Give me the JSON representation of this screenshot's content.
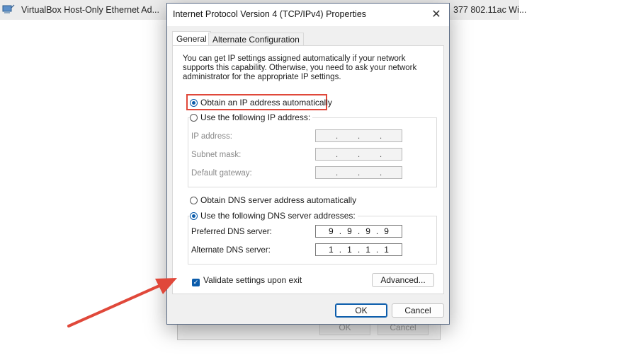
{
  "background": {
    "adapter_left": "VirtualBox Host-Only Ethernet Ad...",
    "adapter_right": "377 802.11ac Wi...",
    "ok_label": "OK",
    "cancel_label": "Cancel"
  },
  "dialog": {
    "title": "Internet Protocol Version 4 (TCP/IPv4) Properties",
    "close_glyph": "✕",
    "tabs": [
      {
        "label": "General",
        "selected": true
      },
      {
        "label": "Alternate Configuration",
        "selected": false
      }
    ],
    "description": "You can get IP settings assigned automatically if your network supports this capability. Otherwise, you need to ask your network administrator for the appropriate IP settings.",
    "ip_options": {
      "auto_label": "Obtain an IP address automatically",
      "manual_label": "Use the following IP address:",
      "selected": "auto"
    },
    "ip_fields": [
      {
        "label": "IP address:",
        "value": ". . ."
      },
      {
        "label": "Subnet mask:",
        "value": ". . ."
      },
      {
        "label": "Default gateway:",
        "value": ". . ."
      }
    ],
    "dns_options": {
      "auto_label": "Obtain DNS server address automatically",
      "manual_label": "Use the following DNS server addresses:",
      "selected": "manual"
    },
    "dns_fields": [
      {
        "label": "Preferred DNS server:",
        "octets": [
          "9",
          "9",
          "9",
          "9"
        ]
      },
      {
        "label": "Alternate DNS server:",
        "octets": [
          "1",
          "1",
          "1",
          "1"
        ]
      }
    ],
    "validate": {
      "label": "Validate settings upon exit",
      "checked": true
    },
    "advanced_label": "Advanced...",
    "ok_label": "OK",
    "cancel_label": "Cancel"
  },
  "colors": {
    "accent": "#0b5cab",
    "annotation_red": "#e0483a"
  }
}
